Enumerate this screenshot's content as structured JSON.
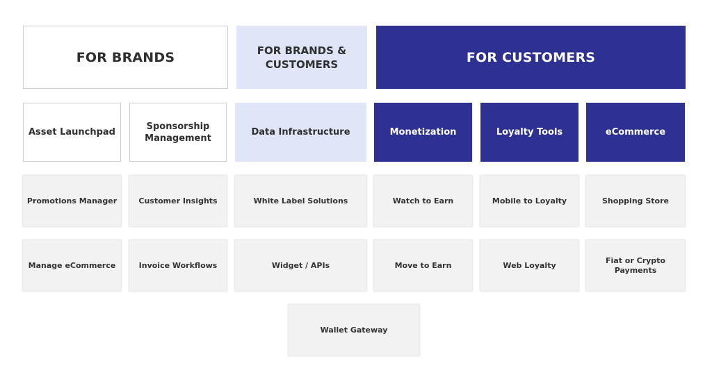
{
  "headers": {
    "brands": "FOR BRANDS",
    "both": "FOR BRANDS & CUSTOMERS",
    "customers": "FOR CUSTOMERS"
  },
  "categories": [
    "Asset Launchpad",
    "Sponsorship Management",
    "Data Infrastructure",
    "Monetization",
    "Loyalty Tools",
    "eCommerce"
  ],
  "row1": [
    "Promotions Manager",
    "Customer Insights",
    "White Label Solutions",
    "Watch to Earn",
    "Mobile to Loyalty",
    "Shopping Store"
  ],
  "row2": [
    "Manage eCommerce",
    "Invoice Workflows",
    "Widget / APIs",
    "Move to Earn",
    "Web Loyalty",
    "Fiat or Crypto Payments"
  ],
  "bottom": "Wallet Gateway",
  "colors": {
    "brand_dark": "#2e3192",
    "brand_light": "#e0e6f8",
    "card": "#f2f2f2"
  }
}
